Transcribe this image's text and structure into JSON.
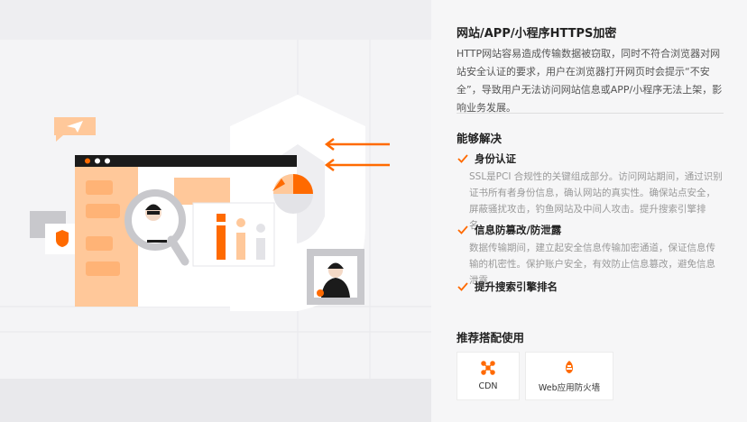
{
  "product": {
    "title": "网站/APP/小程序HTTPS加密",
    "description": "HTTP网站容易造成传输数据被窃取，同时不符合浏览器对网站安全认证的要求，用户在浏览器打开网页时会提示“不安全”，导致用户无法访问网站信息或APP/小程序无法上架，影响业务发展。"
  },
  "solutions": {
    "title": "能够解决",
    "items": [
      {
        "title": "身份认证",
        "description": "SSL是PCI 合规性的关键组成部分。访问网站期间，通过识别证书所有者身份信息，确认网站的真实性。确保站点安全，屏蔽骚扰攻击，钓鱼网站及中间人攻击。提升搜索引擎排名。"
      },
      {
        "title": "信息防篡改/防泄露",
        "description": "数据传输期间，建立起安全信息传输加密通道，保证信息传输的机密性。保护账户安全，有效防止信息篡改，避免信息泄露。"
      },
      {
        "title": "提升搜索引擎排名",
        "description": ""
      }
    ]
  },
  "recommend": {
    "title": "推荐搭配使用",
    "cards": [
      {
        "label": "CDN",
        "icon": "cdn-icon"
      },
      {
        "label": "Web应用防火墙",
        "icon": "firewall-icon"
      }
    ]
  },
  "colors": {
    "accent": "#ff6a00",
    "accent_light": "#ffc89a",
    "dark": "#1b1b1b",
    "grey": "#c8c8cc"
  }
}
